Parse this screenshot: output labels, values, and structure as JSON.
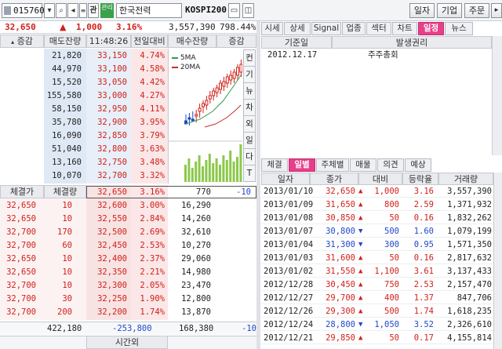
{
  "toolbar": {
    "code": "015760",
    "badge_top": "관",
    "badge_left": "관리",
    "name": "한국전력",
    "index": "KOSPI200",
    "btn_daily": "일자",
    "btn_company": "기업",
    "btn_order": "주문"
  },
  "quote": {
    "price": "32,650",
    "change_arrow": "▲",
    "change": "1,000",
    "rate": "3.16%",
    "volume": "3,557,390",
    "amount": "798.44%"
  },
  "orderbook": {
    "headers": {
      "change": "증감",
      "sell_qty": "매도잔량",
      "time": "11:48:26",
      "prev": "전일대비",
      "buy_qty": "매수잔량",
      "change2": "증감"
    },
    "asks": [
      {
        "qty": "21,820",
        "price": "33,150",
        "rate": "4.74%"
      },
      {
        "qty": "44,970",
        "price": "33,100",
        "rate": "4.58%"
      },
      {
        "qty": "15,520",
        "price": "33,050",
        "rate": "4.42%"
      },
      {
        "qty": "155,580",
        "price": "33,000",
        "rate": "4.27%"
      },
      {
        "qty": "58,150",
        "price": "32,950",
        "rate": "4.11%"
      },
      {
        "qty": "35,780",
        "price": "32,900",
        "rate": "3.95%"
      },
      {
        "qty": "16,090",
        "price": "32,850",
        "rate": "3.79%"
      },
      {
        "qty": "51,040",
        "price": "32,800",
        "rate": "3.63%"
      },
      {
        "qty": "13,160",
        "price": "32,750",
        "rate": "3.48%"
      },
      {
        "qty": "10,070",
        "price": "32,700",
        "rate": "3.32%"
      }
    ],
    "bids": [
      {
        "price": "32,650",
        "rate": "3.16%",
        "qty": "770",
        "chg": "-10"
      },
      {
        "price": "32,600",
        "rate": "3.00%",
        "qty": "16,290",
        "chg": ""
      },
      {
        "price": "32,550",
        "rate": "2.84%",
        "qty": "14,260",
        "chg": ""
      },
      {
        "price": "32,500",
        "rate": "2.69%",
        "qty": "32,610",
        "chg": ""
      },
      {
        "price": "32,450",
        "rate": "2.53%",
        "qty": "10,270",
        "chg": ""
      },
      {
        "price": "32,400",
        "rate": "2.37%",
        "qty": "29,060",
        "chg": ""
      },
      {
        "price": "32,350",
        "rate": "2.21%",
        "qty": "14,980",
        "chg": ""
      },
      {
        "price": "32,300",
        "rate": "2.05%",
        "qty": "23,470",
        "chg": ""
      },
      {
        "price": "32,250",
        "rate": "1.90%",
        "qty": "12,800",
        "chg": ""
      },
      {
        "price": "32,200",
        "rate": "1.74%",
        "qty": "13,870",
        "chg": ""
      }
    ],
    "ticks_header": {
      "price": "체결가",
      "qty": "체결량"
    },
    "ticks": [
      {
        "price": "32,650",
        "qty": "10"
      },
      {
        "price": "32,650",
        "qty": "10"
      },
      {
        "price": "32,700",
        "qty": "170"
      },
      {
        "price": "32,700",
        "qty": "60"
      },
      {
        "price": "32,650",
        "qty": "10"
      },
      {
        "price": "32,650",
        "qty": "10"
      },
      {
        "price": "32,700",
        "qty": "10"
      },
      {
        "price": "32,700",
        "qty": "30"
      },
      {
        "price": "32,700",
        "qty": "200"
      }
    ],
    "total_sell": "422,180",
    "total_diff": "-253,800",
    "total_buy": "168,380",
    "total_chg": "-10",
    "after_hours": "시간외"
  },
  "mini_chart": {
    "legend_5ma": "5MA",
    "legend_20ma": "20MA",
    "side_tabs": [
      "컨",
      "기",
      "뉴",
      "차",
      "외",
      "일",
      "다",
      "T"
    ]
  },
  "right_tabs": [
    "시세",
    "상세",
    "Signal",
    "업종",
    "섹터",
    "차트",
    "일정",
    "뉴스"
  ],
  "schedule": {
    "headers": {
      "date": "기준일",
      "event": "발생권리"
    },
    "rows": [
      {
        "date": "2012.12.17",
        "event": "주주총회"
      }
    ]
  },
  "sub_tabs": [
    "체결",
    "일별",
    "주체별",
    "매물",
    "의견",
    "예상"
  ],
  "daily": {
    "headers": {
      "date": "일자",
      "close": "종가",
      "diff": "대비",
      "rate": "등락율",
      "volume": "거래량"
    },
    "rows": [
      {
        "date": "2013/01/10",
        "close": "32,650",
        "dir": "up",
        "diff": "1,000",
        "rate": "3.16",
        "volume": "3,557,390"
      },
      {
        "date": "2013/01/09",
        "close": "31,650",
        "dir": "up",
        "diff": "800",
        "rate": "2.59",
        "volume": "1,371,932"
      },
      {
        "date": "2013/01/08",
        "close": "30,850",
        "dir": "up",
        "diff": "50",
        "rate": "0.16",
        "volume": "1,832,262"
      },
      {
        "date": "2013/01/07",
        "close": "30,800",
        "dir": "down",
        "diff": "500",
        "rate": "1.60",
        "volume": "1,079,199"
      },
      {
        "date": "2013/01/04",
        "close": "31,300",
        "dir": "down",
        "diff": "300",
        "rate": "0.95",
        "volume": "1,571,350"
      },
      {
        "date": "2013/01/03",
        "close": "31,600",
        "dir": "up",
        "diff": "50",
        "rate": "0.16",
        "volume": "2,817,632"
      },
      {
        "date": "2013/01/02",
        "close": "31,550",
        "dir": "up",
        "diff": "1,100",
        "rate": "3.61",
        "volume": "3,137,433"
      },
      {
        "date": "2012/12/28",
        "close": "30,450",
        "dir": "up",
        "diff": "750",
        "rate": "2.53",
        "volume": "2,157,470"
      },
      {
        "date": "2012/12/27",
        "close": "29,700",
        "dir": "up",
        "diff": "400",
        "rate": "1.37",
        "volume": "847,706"
      },
      {
        "date": "2012/12/26",
        "close": "29,300",
        "dir": "up",
        "diff": "500",
        "rate": "1.74",
        "volume": "1,618,235"
      },
      {
        "date": "2012/12/24",
        "close": "28,800",
        "dir": "down",
        "diff": "1,050",
        "rate": "3.52",
        "volume": "2,326,610"
      },
      {
        "date": "2012/12/21",
        "close": "29,850",
        "dir": "up",
        "diff": "50",
        "rate": "0.17",
        "volume": "4,155,814"
      }
    ]
  },
  "colors": {
    "up": "#d0201a",
    "down": "#1f48c8",
    "accent": "#e6408a"
  }
}
